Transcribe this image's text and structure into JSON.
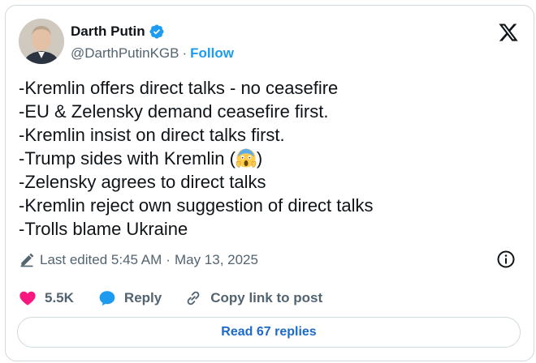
{
  "author": {
    "name": "Darth Putin",
    "handle": "@DarthPutinKGB",
    "follow_label": "Follow"
  },
  "tweet": {
    "lines": [
      "-Kremlin offers direct talks - no ceasefire",
      "-EU & Zelensky demand ceasefire first.",
      "-Kremlin insist on direct talks first.",
      "-Trump sides with Kremlin (",
      "-Zelensky agrees to direct talks",
      "-Kremlin reject own suggestion of direct talks",
      "-Trolls blame Ukraine"
    ],
    "line4_suffix": ")"
  },
  "meta": {
    "edited_label": "Last edited 5:45 AM",
    "date": "May 13, 2025"
  },
  "actions": {
    "likes": "5.5K",
    "reply_label": "Reply",
    "copy_label": "Copy link to post"
  },
  "replies_button": "Read 67 replies",
  "colors": {
    "accent": "#1d9bf0",
    "like": "#f91880",
    "verified": "#1d9bf0",
    "border": "#cfd9de",
    "secondary_text": "#536471"
  },
  "icons": {
    "verified": "verified-badge-icon",
    "x_logo": "x-logo-icon",
    "edit": "pencil-icon",
    "info": "info-icon",
    "like": "heart-icon",
    "reply": "speech-bubble-icon",
    "copy": "link-icon",
    "emoji": "screaming-face-emoji"
  }
}
